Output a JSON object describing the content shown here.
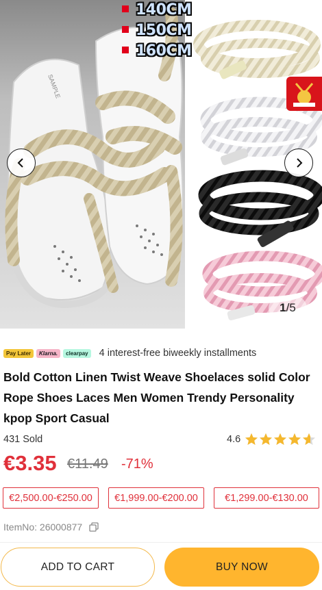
{
  "gallery": {
    "size_tags": [
      "140CM",
      "150CM",
      "160CM"
    ],
    "counter_current": "1",
    "counter_total": "/5",
    "shoe_print": "SAMPLE",
    "lace_colors": [
      "#e9e2cc",
      "#f2f2f4",
      "#1b1b1b",
      "#f0b9c9"
    ]
  },
  "payment": {
    "chips": [
      "Pay Later",
      "Klarna.",
      "clearpay"
    ],
    "text": "4 interest-free biweekly installments"
  },
  "product": {
    "title": "Bold Cotton Linen Twist Weave Shoelaces solid Color Rope Shoes Laces Men Women Trendy Personality kpop Sport Casual",
    "sold": "431 Sold",
    "rating": "4.6",
    "rating_value": 4.6,
    "price": "€3.35",
    "old_price": "€11.49",
    "discount": "-71%",
    "tiers": [
      "€2,500.00-€250.00",
      "€1,999.00-€200.00",
      "€1,299.00-€130.00"
    ],
    "item_no": "ItemNo: 26000877"
  },
  "actions": {
    "add_to_cart": "ADD TO CART",
    "buy_now": "BUY NOW"
  },
  "colors": {
    "accent_red": "#e0303a",
    "buy_yellow": "#ffb52e",
    "cart_border": "#f3b84a",
    "star": "#f5b82e"
  }
}
